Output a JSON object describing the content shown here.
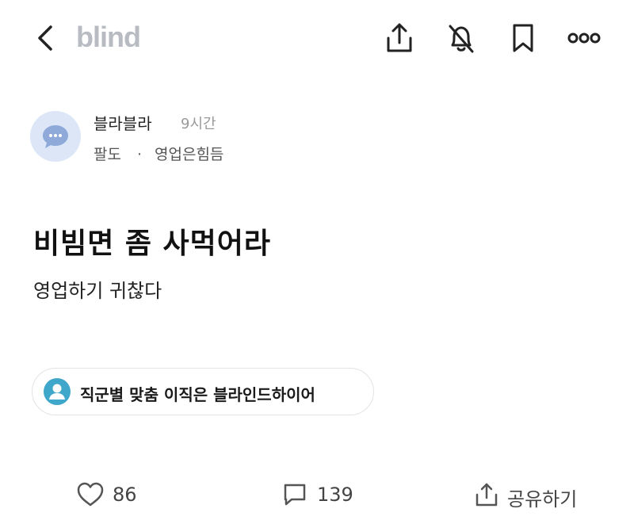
{
  "header": {
    "logo_text": "blind",
    "icons": [
      "back-arrow-icon",
      "share-upload-icon",
      "notification-off-icon",
      "bookmark-icon",
      "more-icon"
    ]
  },
  "author": {
    "name": "블라블라",
    "time": "9시간",
    "company": "팔도",
    "separator": "·",
    "channel": "영업은힘듬",
    "avatar_icon": "chat-bubble-icon"
  },
  "post": {
    "title": "비빔면 좀 사먹어라",
    "body": "영업하기 귀찮다"
  },
  "promo": {
    "text": "직군별 맞춤 이직은 블라인드하이어",
    "icon": "person-icon",
    "icon_color": "#3fa7c9"
  },
  "actions": {
    "likes": "86",
    "comments": "139",
    "share_label": "공유하기"
  },
  "colors": {
    "logo": "#b8bcc2",
    "avatar_bg": "#dce6f7",
    "avatar_icon": "#8fa9d9"
  }
}
